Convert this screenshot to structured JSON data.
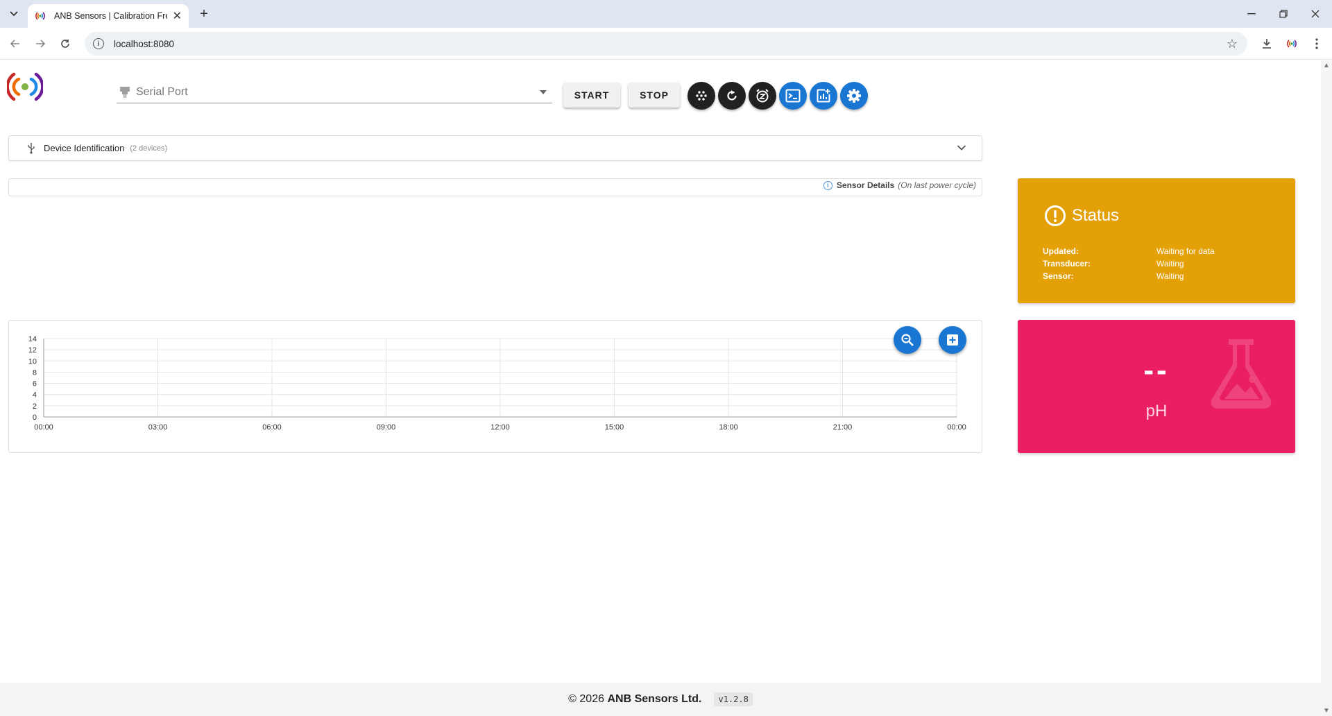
{
  "browser": {
    "tab_title": "ANB Sensors | Calibration Free",
    "url": "localhost:8080",
    "icons": [
      "tab-list-icon",
      "close-icon",
      "plus-icon",
      "minimize-icon",
      "restore-icon",
      "back-icon",
      "forward-icon",
      "reload-icon",
      "info-icon",
      "star-icon",
      "download-icon",
      "extension-icon",
      "kebab-menu-icon"
    ]
  },
  "header": {
    "serial_port_placeholder": "Serial Port",
    "start_label": "START",
    "stop_label": "STOP",
    "icon_buttons": [
      {
        "name": "dialpad-icon",
        "color": "#212121"
      },
      {
        "name": "restart-icon",
        "color": "#212121"
      },
      {
        "name": "snooze-icon",
        "color": "#212121"
      },
      {
        "name": "terminal-icon",
        "color": "#1976d2"
      },
      {
        "name": "add-chart-icon",
        "color": "#1976d2"
      },
      {
        "name": "settings-icon",
        "color": "#1976d2"
      }
    ]
  },
  "device_panel": {
    "title": "Device Identification",
    "count": "(2 devices)"
  },
  "sensor_details": {
    "title": "Sensor Details",
    "subtitle": "(On last power cycle)"
  },
  "status": {
    "title": "Status",
    "color": "#e3a007",
    "rows": [
      {
        "key": "Updated:",
        "value": "Waiting for data"
      },
      {
        "key": "Transducer:",
        "value": "Waiting"
      },
      {
        "key": "Sensor:",
        "value": "Waiting"
      }
    ]
  },
  "ph": {
    "value": "--",
    "unit": "pH",
    "color": "#e91e63"
  },
  "chart_data": {
    "type": "line",
    "title": "",
    "xlabel": "",
    "ylabel": "",
    "x_ticks": [
      "00:00",
      "03:00",
      "06:00",
      "09:00",
      "12:00",
      "15:00",
      "18:00",
      "21:00",
      "00:00"
    ],
    "y_ticks": [
      0,
      2,
      4,
      6,
      8,
      10,
      12,
      14
    ],
    "ylim": [
      0,
      14
    ],
    "grid": true,
    "series": []
  },
  "chart_actions": {
    "zoom_icon": "zoom-out-icon",
    "add_icon": "add-box-icon"
  },
  "footer": {
    "copyright": "© 2026",
    "company": "ANB Sensors Ltd.",
    "version": "v1.2.8"
  }
}
